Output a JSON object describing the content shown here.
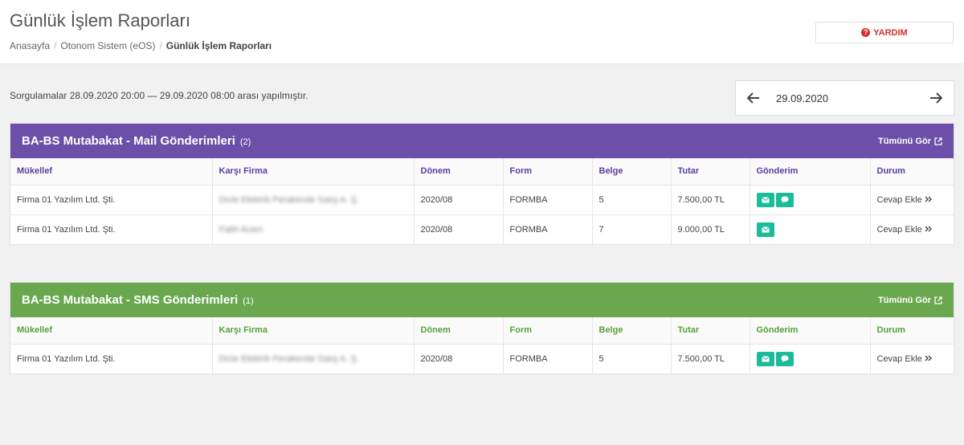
{
  "header": {
    "title": "Günlük İşlem Raporları",
    "breadcrumb": [
      "Anasayfa",
      "Otonom Sistem (eOS)",
      "Günlük İşlem Raporları"
    ],
    "help_label": "YARDIM"
  },
  "query": {
    "info": "Sorgulamalar 28.09.2020 20:00 — 29.09.2020 08:00 arası yapılmıştır.",
    "date": "29.09.2020"
  },
  "columns": [
    "Mükellef",
    "Karşı Firma",
    "Dönem",
    "Form",
    "Belge",
    "Tutar",
    "Gönderim",
    "Durum"
  ],
  "mail_panel": {
    "title": "BA-BS Mutabakat - Mail Gönderimleri",
    "count": "(2)",
    "see_all": "Tümünü Gör",
    "rows": [
      {
        "mukellef": "Firma 01 Yazılım Ltd. Şti.",
        "karsi": "Dicle Elektrik Perakende Satış A. Ş.",
        "donem": "2020/08",
        "form": "FORMBA",
        "belge": "5",
        "tutar": "7.500,00 TL",
        "durum": "Cevap Ekle"
      },
      {
        "mukellef": "Firma 01 Yazılım Ltd. Şti.",
        "karsi": "Fatih Acem",
        "donem": "2020/08",
        "form": "FORMBA",
        "belge": "7",
        "tutar": "9.000,00 TL",
        "durum": "Cevap Ekle"
      }
    ]
  },
  "sms_panel": {
    "title": "BA-BS Mutabakat - SMS Gönderimleri",
    "count": "(1)",
    "see_all": "Tümünü Gör",
    "rows": [
      {
        "mukellef": "Firma 01 Yazılım Ltd. Şti.",
        "karsi": "Dicle Elektrik Perakende Satış A. Ş.",
        "donem": "2020/08",
        "form": "FORMBA",
        "belge": "5",
        "tutar": "7.500,00 TL",
        "durum": "Cevap Ekle"
      }
    ]
  },
  "colors": {
    "purple": "#6b4fa8",
    "green": "#6aa84f",
    "teal": "#1abc9c",
    "danger": "#d32f2f"
  },
  "icons": {
    "mail": "envelope-icon",
    "sms": "chat-bubble-icon",
    "help": "question-circle-icon",
    "external": "external-link-icon"
  }
}
